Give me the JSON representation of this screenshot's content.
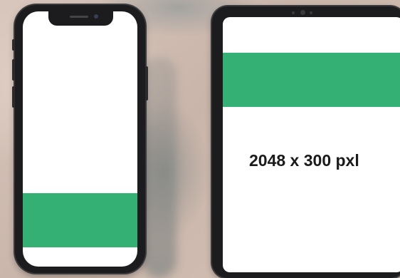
{
  "tablet": {
    "size_label": "2048 x 300 pxl"
  },
  "colors": {
    "banner": "#35b074",
    "screen": "#ffffff",
    "device_frame": "#1c1c1e"
  },
  "icons": {
    "phone_camera": "camera-icon",
    "tablet_camera": "camera-icon"
  }
}
